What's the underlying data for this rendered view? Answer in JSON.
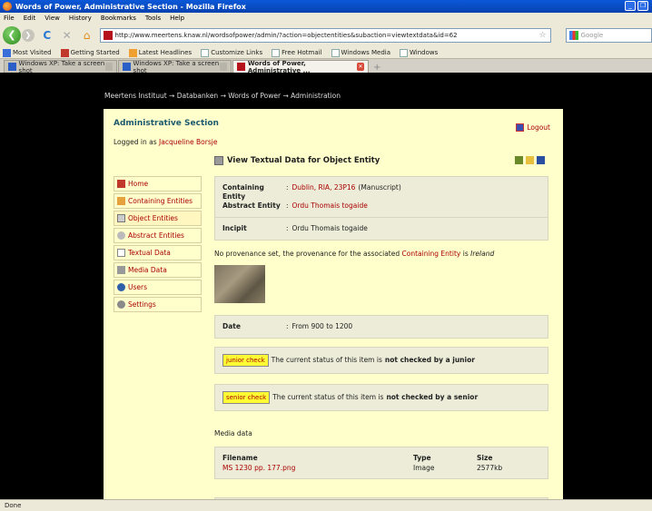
{
  "window": {
    "title": "Words of Power, Administrative Section - Mozilla Firefox"
  },
  "menu": [
    "File",
    "Edit",
    "View",
    "History",
    "Bookmarks",
    "Tools",
    "Help"
  ],
  "nav": {
    "url": "http://www.meertens.knaw.nl/wordsofpower/admin/?action=objectentities&subaction=viewtextdata&id=62",
    "search_placeholder": "Google"
  },
  "bookmarks": [
    "Most Visited",
    "Getting Started",
    "Latest Headlines",
    "Customize Links",
    "Free Hotmail",
    "Windows Media",
    "Windows"
  ],
  "tabs": [
    {
      "label": "Windows XP: Take a screen shot",
      "active": false
    },
    {
      "label": "Windows XP: Take a screen shot",
      "active": false
    },
    {
      "label": "Words of Power, Administrative ...",
      "active": true
    }
  ],
  "breadcrumb": "Meertens Instituut → Databanken → Words of Power → Administration",
  "header": {
    "title": "Administrative Section",
    "logged_prefix": "Logged in as",
    "user": "Jacqueline Borsje",
    "logout": "Logout"
  },
  "sidebar": [
    {
      "label": "Home",
      "icon": "home-icon"
    },
    {
      "label": "Containing Entities",
      "icon": "folder-icon"
    },
    {
      "label": "Object Entities",
      "icon": "document-icon"
    },
    {
      "label": "Abstract Entities",
      "icon": "abstract-icon"
    },
    {
      "label": "Textual Data",
      "icon": "text-icon"
    },
    {
      "label": "Media Data",
      "icon": "speaker-icon"
    },
    {
      "label": "Users",
      "icon": "users-icon"
    },
    {
      "label": "Settings",
      "icon": "gear-icon"
    }
  ],
  "view": {
    "title": "View Textual Data for Object Entity",
    "containing_label": "Containing Entity",
    "containing_value": "Dublin, RIA, 23P16",
    "containing_type": "(Manuscript)",
    "abstract_label": "Abstract Entity",
    "abstract_value": "Ordu Thomais togaide",
    "incipit_label": "Incipit",
    "incipit_value": "Ordu Thomais togaide",
    "prov_prefix": "No provenance set, the provenance for the associated",
    "prov_link": "Containing Entity",
    "prov_mid": "is",
    "prov_place": "Ireland",
    "date_label": "Date",
    "date_value": "From 900 to 1200",
    "junior_badge": "junior check",
    "junior_text": "The current status of this item is",
    "junior_status": "not checked by a junior",
    "senior_badge": "senior check",
    "senior_text": "The current status of this item is",
    "senior_status": "not checked by a senior"
  },
  "media": {
    "label": "Media data",
    "headers": {
      "filename": "Filename",
      "type": "Type",
      "size": "Size"
    },
    "row": {
      "filename": "MS 1230 pp. 177.png",
      "type": "Image",
      "size": "2577kb"
    }
  },
  "status": "Done"
}
